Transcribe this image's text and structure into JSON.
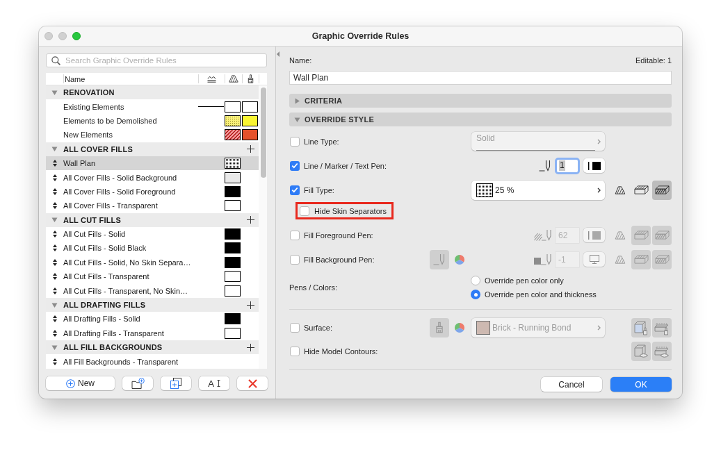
{
  "window": {
    "title": "Graphic Override Rules",
    "controls": [
      {
        "kind": "close",
        "enabled": false
      },
      {
        "kind": "minimize",
        "enabled": false
      },
      {
        "kind": "zoom",
        "enabled": true
      }
    ]
  },
  "sidebar": {
    "search": {
      "placeholder": "Search Graphic Override Rules"
    },
    "column_header": "Name",
    "groups": [
      {
        "title": "RENOVATION",
        "expanded": true,
        "can_add": false,
        "items": [
          {
            "name": "Existing Elements",
            "kind": "fixed",
            "selected": false,
            "line": true,
            "swatches": [
              {
                "kind": "solid",
                "color": "#ffffff"
              },
              {
                "kind": "solid",
                "color": "#ffffff"
              }
            ]
          },
          {
            "name": "Elements to be Demolished",
            "kind": "fixed",
            "selected": false,
            "line": false,
            "swatches": [
              {
                "kind": "dots",
                "color": "#f9f07a"
              },
              {
                "kind": "solid",
                "color": "#f9f533"
              }
            ]
          },
          {
            "name": "New Elements",
            "kind": "fixed",
            "selected": false,
            "line": false,
            "swatches": [
              {
                "kind": "hatch",
                "color": "#f49a9a"
              },
              {
                "kind": "solid",
                "color": "#e5512b"
              }
            ]
          }
        ]
      },
      {
        "title": "ALL COVER FILLS",
        "expanded": true,
        "can_add": true,
        "items": [
          {
            "name": "Wall Plan",
            "kind": "rule",
            "selected": true,
            "line": false,
            "swatches": [
              {
                "kind": "dense-dots"
              }
            ]
          },
          {
            "name": "All Cover Fills - Solid Background",
            "kind": "rule",
            "selected": false,
            "line": false,
            "swatches": [
              {
                "kind": "solid",
                "color": "#e9e9e9"
              }
            ]
          },
          {
            "name": "All Cover Fills - Solid Foreground",
            "kind": "rule",
            "selected": false,
            "line": false,
            "swatches": [
              {
                "kind": "solid",
                "color": "#000000"
              }
            ]
          },
          {
            "name": "All Cover Fills - Transparent",
            "kind": "rule",
            "selected": false,
            "line": false,
            "swatches": [
              {
                "kind": "solid",
                "color": "#ffffff"
              }
            ]
          }
        ]
      },
      {
        "title": "ALL CUT FILLS",
        "expanded": true,
        "can_add": true,
        "items": [
          {
            "name": "All Cut Fills - Solid",
            "kind": "rule",
            "selected": false,
            "line": false,
            "swatches": [
              {
                "kind": "solid",
                "color": "#000000"
              }
            ]
          },
          {
            "name": "All Cut Fills - Solid Black",
            "kind": "rule",
            "selected": false,
            "line": false,
            "swatches": [
              {
                "kind": "solid",
                "color": "#000000"
              }
            ]
          },
          {
            "name": "All Cut Fills - Solid, No Skin Separa…",
            "kind": "rule",
            "selected": false,
            "line": false,
            "swatches": [
              {
                "kind": "solid",
                "color": "#000000"
              }
            ]
          },
          {
            "name": "All Cut Fills - Transparent",
            "kind": "rule",
            "selected": false,
            "line": false,
            "swatches": [
              {
                "kind": "solid",
                "color": "#ffffff"
              }
            ]
          },
          {
            "name": "All Cut Fills - Transparent, No Skin…",
            "kind": "rule",
            "selected": false,
            "line": false,
            "swatches": [
              {
                "kind": "solid",
                "color": "#ffffff"
              }
            ]
          }
        ]
      },
      {
        "title": "ALL DRAFTING FILLS",
        "expanded": true,
        "can_add": true,
        "items": [
          {
            "name": "All Drafting Fills - Solid",
            "kind": "rule",
            "selected": false,
            "line": false,
            "swatches": [
              {
                "kind": "solid",
                "color": "#000000"
              }
            ]
          },
          {
            "name": "All Drafting Fills - Transparent",
            "kind": "rule",
            "selected": false,
            "line": false,
            "swatches": [
              {
                "kind": "solid",
                "color": "#ffffff"
              }
            ]
          }
        ]
      },
      {
        "title": "ALL FILL BACKGROUNDS",
        "expanded": true,
        "can_add": true,
        "items": [
          {
            "name": "All Fill Backgrounds - Transparent",
            "kind": "rule",
            "selected": false,
            "line": false
          }
        ]
      }
    ]
  },
  "actions": [
    {
      "kind": "new",
      "label": "New"
    },
    {
      "kind": "new-folder"
    },
    {
      "kind": "duplicate"
    },
    {
      "kind": "rename",
      "glyph": "A"
    },
    {
      "kind": "delete"
    }
  ],
  "details": {
    "name_label": "Name:",
    "editable": "Editable: 1",
    "name_value": "Wall Plan",
    "sections": [
      {
        "title": "CRITERIA",
        "expanded": false
      },
      {
        "title": "OVERRIDE STYLE",
        "expanded": true
      }
    ],
    "pen_settings": [
      {
        "kind": "line-type",
        "label": "Line Type:",
        "checked": false,
        "value": "Solid"
      },
      {
        "kind": "pen",
        "label": "Line / Marker / Text Pen:",
        "checked": true,
        "pen": "1",
        "focused": true
      },
      {
        "kind": "fill",
        "label": "Fill Type:",
        "checked": true,
        "value": "25 %",
        "modes": [
          {
            "selected": false
          },
          {
            "selected": false
          },
          {
            "selected": true
          }
        ]
      },
      {
        "kind": "sub-option",
        "label": "Hide Skin Separators",
        "checked": false,
        "highlighted": true
      },
      {
        "kind": "fill-foreground",
        "label": "Fill Foreground Pen:",
        "checked": false,
        "pen": "62",
        "focused": false,
        "modes": [
          {
            "selected": false
          },
          {
            "selected": true
          },
          {
            "selected": true
          }
        ]
      },
      {
        "kind": "fill-background",
        "label": "Fill Background Pen:",
        "checked": false,
        "pen": "-1",
        "focused": false,
        "modes": [
          {
            "selected": false
          },
          {
            "selected": true
          },
          {
            "selected": true
          }
        ]
      },
      {
        "kind": "pens-colors",
        "label": "Pens / Colors:",
        "options": [
          {
            "label": "Override pen color only",
            "selected": false
          },
          {
            "label": "Override pen color and thickness",
            "selected": true
          }
        ]
      }
    ],
    "model_settings": [
      {
        "kind": "surface",
        "label": "Surface:",
        "checked": false,
        "value": "Brick - Running Bond",
        "color": "#cdb9b1",
        "modes": [
          {
            "selected": true
          },
          {
            "selected": true
          }
        ]
      },
      {
        "kind": "contours",
        "label": "Hide Model Contours:",
        "checked": false,
        "modes": [
          {
            "selected": true
          },
          {
            "selected": true
          }
        ]
      }
    ],
    "buttons": [
      {
        "kind": "cancel",
        "label": "Cancel"
      },
      {
        "kind": "primary",
        "label": "OK"
      }
    ]
  }
}
